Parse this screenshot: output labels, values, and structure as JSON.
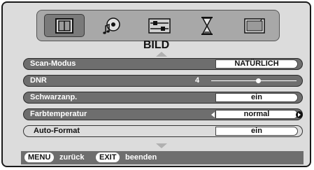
{
  "menu": {
    "title": "BILD",
    "tabs": [
      {
        "name": "picture",
        "icon": "picture-frame-icon",
        "active": true
      },
      {
        "name": "sound",
        "icon": "music-disc-icon",
        "active": false
      },
      {
        "name": "settings",
        "icon": "sliders-icon",
        "active": false
      },
      {
        "name": "timer",
        "icon": "hourglass-icon",
        "active": false
      },
      {
        "name": "setup",
        "icon": "screen-icon",
        "active": false
      }
    ]
  },
  "rows": {
    "scan_mode": {
      "label": "Scan-Modus",
      "value": "NATÜRLICH"
    },
    "dnr": {
      "label": "DNR",
      "value": "4",
      "level": 0.55
    },
    "black_adjust": {
      "label": "Schwarzanp.",
      "value": "ein"
    },
    "color_temp": {
      "label": "Farbtemperatur",
      "value": "normal"
    },
    "auto_format": {
      "label": "Auto-Format",
      "value": "ein"
    }
  },
  "footer": {
    "menu_key": "MENU",
    "menu_action": "zurück",
    "exit_key": "EXIT",
    "exit_action": "beenden"
  }
}
